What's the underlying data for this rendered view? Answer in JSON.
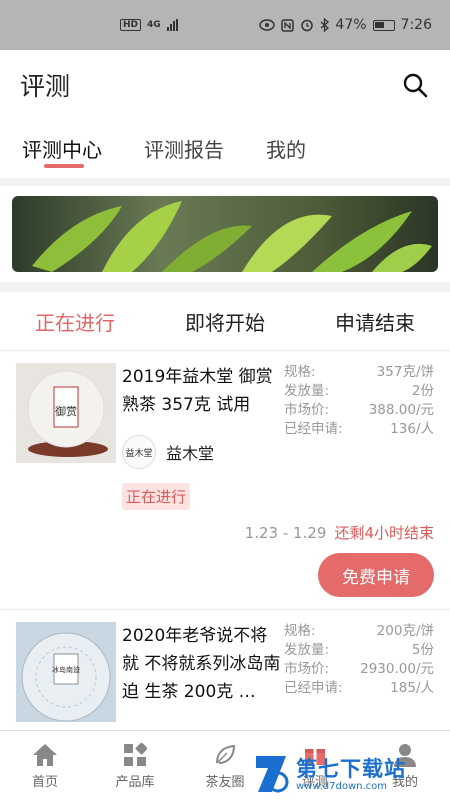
{
  "status_bar": {
    "network": "4G",
    "hd": "HD",
    "battery": "47%",
    "time": "7:26"
  },
  "header": {
    "title": "评测"
  },
  "tabs": [
    {
      "label": "评测中心",
      "active": true
    },
    {
      "label": "评测报告",
      "active": false
    },
    {
      "label": "我的",
      "active": false
    }
  ],
  "status_tabs": [
    {
      "label": "正在进行",
      "active": true
    },
    {
      "label": "即将开始",
      "active": false
    },
    {
      "label": "申请结束",
      "active": false
    }
  ],
  "items": [
    {
      "name": "2019年益木堂 御赏 熟茶 357克 试用",
      "thumb_text": "御赏",
      "brand": "益木堂",
      "brand_logo_text": "益木堂",
      "specs": [
        {
          "label": "规格:",
          "value": "357克/饼"
        },
        {
          "label": "发放量:",
          "value": "2份"
        },
        {
          "label": "市场价:",
          "value": "388.00/元"
        },
        {
          "label": "已经申请:",
          "value": "136/人"
        }
      ],
      "status": "正在进行",
      "date_range": "1.23 - 1.29",
      "remaining": "还剩4小时结束",
      "button": "免费申请"
    },
    {
      "name": "2020年老爷说不将就 不将就系列冰岛南迫 生茶 200克 …",
      "thumb_text": "冰岛南迫",
      "specs": [
        {
          "label": "规格:",
          "value": "200克/饼"
        },
        {
          "label": "发放量:",
          "value": "5份"
        },
        {
          "label": "市场价:",
          "value": "2930.00/元"
        },
        {
          "label": "已经申请:",
          "value": "185/人"
        }
      ]
    }
  ],
  "bottom_nav": [
    {
      "label": "首页",
      "icon": "home-icon"
    },
    {
      "label": "产品库",
      "icon": "grid-icon"
    },
    {
      "label": "茶友圈",
      "icon": "leaf-icon"
    },
    {
      "label": "评测",
      "icon": "gift-icon"
    },
    {
      "label": "我的",
      "icon": "user-icon"
    }
  ],
  "watermark": {
    "title": "第七下载站",
    "url": "www.d7down.com"
  },
  "colors": {
    "accent": "#e56b6b",
    "watermark": "#1a6fd1"
  }
}
